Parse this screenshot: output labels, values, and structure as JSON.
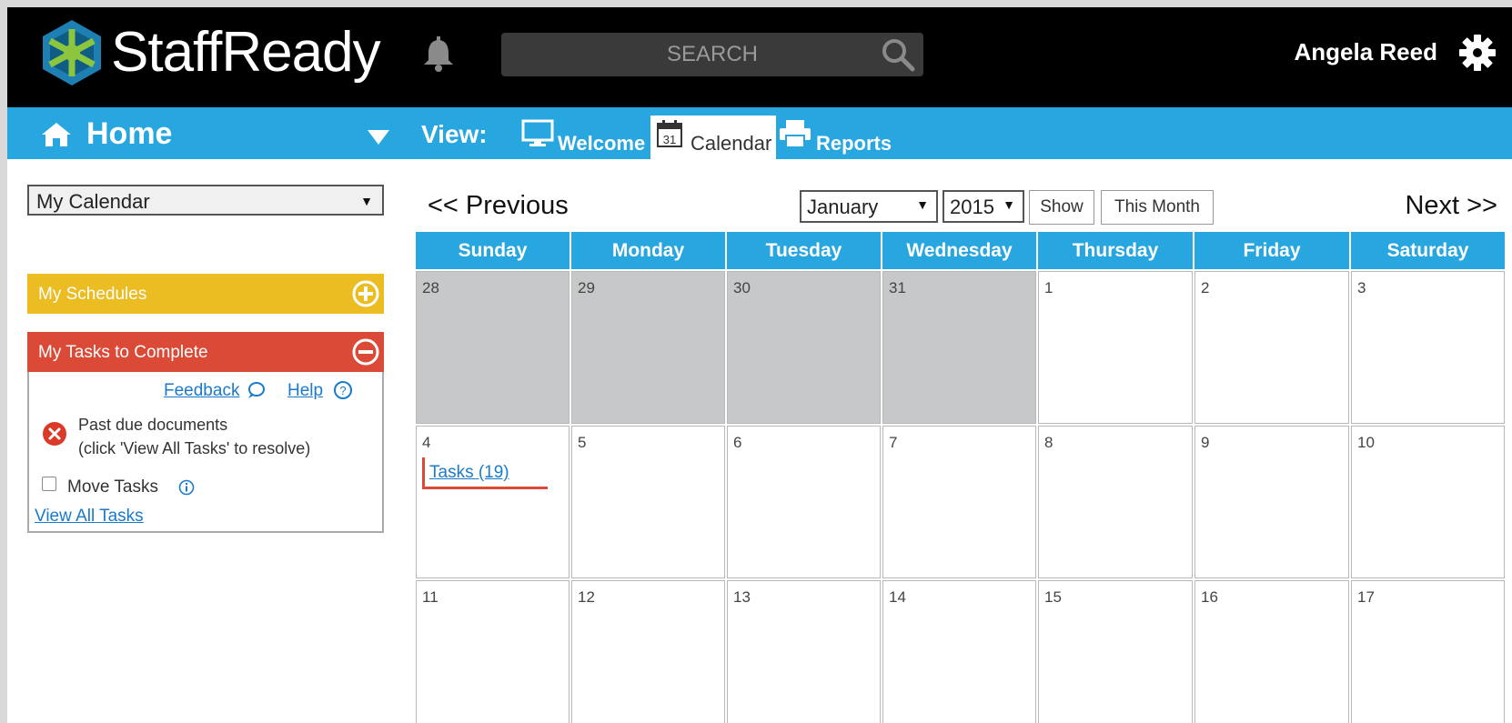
{
  "app": {
    "name": "StaffReady"
  },
  "header": {
    "search_placeholder": "SEARCH",
    "user_name": "Angela Reed"
  },
  "nav": {
    "home_label": "Home",
    "view_label": "View:",
    "tabs": [
      {
        "label": "Welcome",
        "icon": "monitor-icon",
        "active": false
      },
      {
        "label": "Calendar",
        "icon": "calendar-icon",
        "active": true
      },
      {
        "label": "Reports",
        "icon": "printer-icon",
        "active": false
      }
    ]
  },
  "sidebar": {
    "calendar_select": "My Calendar",
    "schedules_title": "My Schedules",
    "tasks_title": "My Tasks to Complete",
    "feedback_link": "Feedback",
    "help_link": "Help",
    "past_due_line1": "Past due documents",
    "past_due_line2": "(click 'View All Tasks' to resolve)",
    "move_tasks_label": "Move Tasks",
    "view_all_link": "View All Tasks"
  },
  "calendar": {
    "prev_label": "<< Previous",
    "next_label": "Next >>",
    "month": "January",
    "year": "2015",
    "show_label": "Show",
    "this_month_label": "This Month",
    "days": [
      "Sunday",
      "Monday",
      "Tuesday",
      "Wednesday",
      "Thursday",
      "Friday",
      "Saturday"
    ],
    "weeks": [
      [
        "28",
        "29",
        "30",
        "31",
        "1",
        "2",
        "3"
      ],
      [
        "4",
        "5",
        "6",
        "7",
        "8",
        "9",
        "10"
      ],
      [
        "11",
        "12",
        "13",
        "14",
        "15",
        "16",
        "17"
      ]
    ],
    "tasks_link": "Tasks (19)"
  },
  "colors": {
    "header_bg": "#000000",
    "nav_bg": "#28a6e0",
    "schedules_bg": "#ebbd22",
    "tasks_bg": "#db4a37",
    "link": "#1a7acb",
    "prev_month_cell": "#c7c8c9"
  }
}
